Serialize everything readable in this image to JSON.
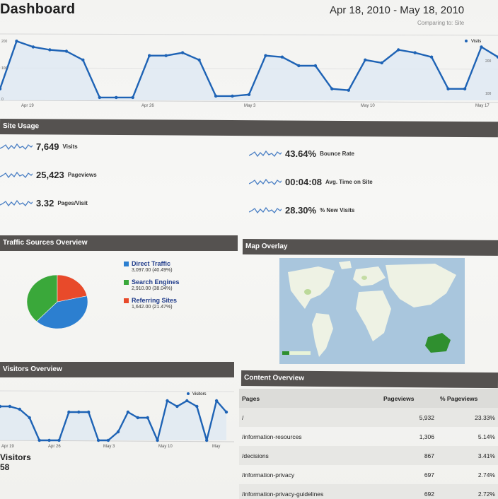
{
  "header": {
    "title": "Dashboard",
    "date_range": "Apr 18, 2010 - May 18, 2010",
    "comparing": "Comparing to: Site"
  },
  "top_chart": {
    "legend": "Visits",
    "yticks": [
      "200",
      "100",
      "0"
    ],
    "right_ticks": [
      "200",
      "100"
    ],
    "xticks": [
      "Apr 19",
      "Apr 26",
      "May 3",
      "May 10",
      "May 17"
    ],
    "values": [
      40,
      205,
      185,
      175,
      170,
      140,
      10,
      10,
      10,
      155,
      155,
      165,
      140,
      15,
      15,
      20,
      155,
      150,
      120,
      120,
      40,
      35,
      140,
      130,
      175,
      165,
      150,
      40,
      40,
      185,
      150
    ],
    "ylim": [
      0,
      230
    ]
  },
  "site_usage": {
    "title": "Site Usage",
    "metrics_left": [
      {
        "value": "7,649",
        "label": "Visits"
      },
      {
        "value": "25,423",
        "label": "Pageviews"
      },
      {
        "value": "3.32",
        "label": "Pages/Visit"
      }
    ],
    "metrics_right": [
      {
        "value": "43.64%",
        "label": "Bounce Rate"
      },
      {
        "value": "00:04:08",
        "label": "Avg. Time on Site"
      },
      {
        "value": "28.30%",
        "label": "% New Visits"
      }
    ]
  },
  "traffic_sources": {
    "title": "Traffic Sources Overview",
    "items": [
      {
        "label": "Direct Traffic",
        "detail": "3,097.00 (40.49%)",
        "percent": 40.49,
        "color": "#2c7fd0"
      },
      {
        "label": "Search Engines",
        "detail": "2,910.00 (38.04%)",
        "percent": 38.04,
        "color": "#3aa83a"
      },
      {
        "label": "Referring Sites",
        "detail": "1,642.00 (21.47%)",
        "percent": 21.47,
        "color": "#e84a2a"
      }
    ]
  },
  "map_overlay": {
    "title": "Map Overlay"
  },
  "visitors_overview": {
    "title": "Visitors Overview",
    "legend": "Visitors",
    "xticks": [
      "Apr 19",
      "Apr 26",
      "May 3",
      "May 10",
      "May"
    ],
    "values": [
      120,
      120,
      110,
      80,
      0,
      0,
      0,
      100,
      100,
      100,
      0,
      0,
      30,
      100,
      80,
      80,
      0,
      140,
      120,
      140,
      120,
      0,
      140,
      100
    ],
    "ylim": [
      0,
      160
    ],
    "summary_label": "Visitors",
    "summary_value": "58"
  },
  "content_overview": {
    "title": "Content Overview",
    "columns": [
      "Pages",
      "Pageviews",
      "% Pageviews"
    ],
    "rows": [
      {
        "page": "/",
        "views": "5,932",
        "pct": "23.33%"
      },
      {
        "page": "/information-resources",
        "views": "1,306",
        "pct": "5.14%"
      },
      {
        "page": "/decisions",
        "views": "867",
        "pct": "3.41%"
      },
      {
        "page": "/information-privacy",
        "views": "697",
        "pct": "2.74%"
      },
      {
        "page": "/information-privacy-guidelines",
        "views": "692",
        "pct": "2.72%"
      }
    ]
  },
  "colors": {
    "line": "#1e63b5",
    "fill": "#dfe8f3",
    "bar": "#555250"
  }
}
